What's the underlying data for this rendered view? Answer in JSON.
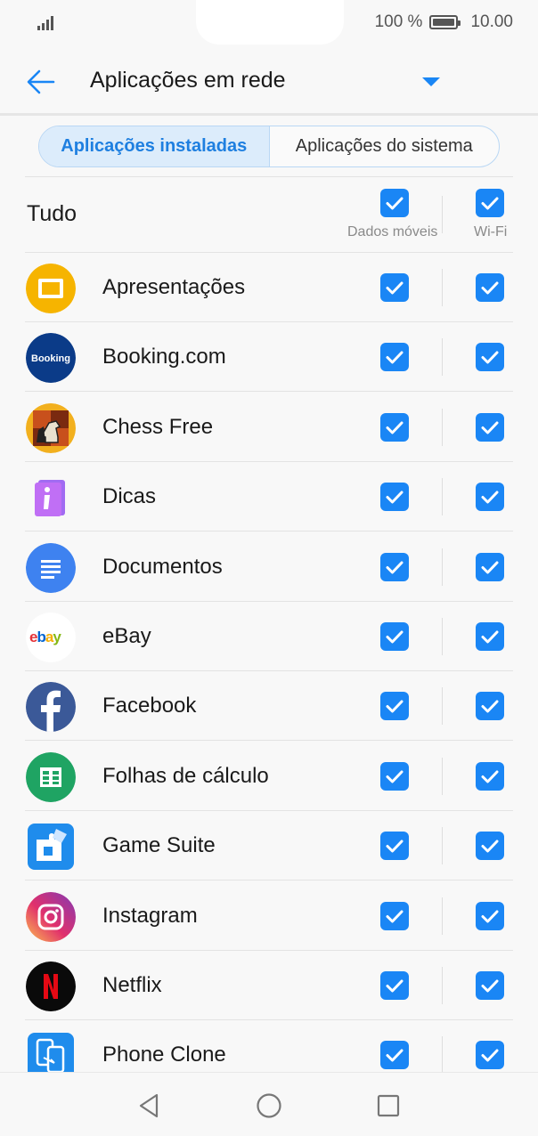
{
  "status": {
    "battery_percent": "100 %",
    "time": "10.00",
    "signal_icon": "signal-icon",
    "battery_icon": "battery-icon"
  },
  "header": {
    "title": "Aplicações em rede",
    "back_icon": "arrow-left-icon",
    "dropdown_icon": "triangle-down-icon"
  },
  "tabs": [
    {
      "label": "Aplicações instaladas",
      "active": true
    },
    {
      "label": "Aplicações do sistema",
      "active": false
    }
  ],
  "all_row": {
    "label": "Tudo",
    "mobile_label": "Dados móveis",
    "wifi_label": "Wi-Fi",
    "mobile_checked": true,
    "wifi_checked": true
  },
  "apps": [
    {
      "name": "Apresentações",
      "icon": "slides-icon",
      "mobile": true,
      "wifi": true
    },
    {
      "name": "Booking.com",
      "icon": "booking-icon",
      "icon_text": "Booking",
      "mobile": true,
      "wifi": true
    },
    {
      "name": "Chess Free",
      "icon": "chess-icon",
      "mobile": true,
      "wifi": true
    },
    {
      "name": "Dicas",
      "icon": "tips-icon",
      "mobile": true,
      "wifi": true
    },
    {
      "name": "Documentos",
      "icon": "docs-icon",
      "mobile": true,
      "wifi": true
    },
    {
      "name": "eBay",
      "icon": "ebay-icon",
      "mobile": true,
      "wifi": true
    },
    {
      "name": "Facebook",
      "icon": "facebook-icon",
      "mobile": true,
      "wifi": true
    },
    {
      "name": "Folhas de cálculo",
      "icon": "sheets-icon",
      "mobile": true,
      "wifi": true
    },
    {
      "name": "Game Suite",
      "icon": "game-suite-icon",
      "mobile": true,
      "wifi": true
    },
    {
      "name": "Instagram",
      "icon": "instagram-icon",
      "mobile": true,
      "wifi": true
    },
    {
      "name": "Netflix",
      "icon": "netflix-icon",
      "mobile": true,
      "wifi": true
    },
    {
      "name": "Phone Clone",
      "icon": "phone-clone-icon",
      "mobile": true,
      "wifi": true
    }
  ],
  "navbar": {
    "back": "nav-back-icon",
    "home": "nav-home-icon",
    "recents": "nav-recents-icon"
  },
  "colors": {
    "accent": "#1a86f5",
    "tab_active_bg": "#dcecfb",
    "tab_active_text": "#1e7fe0"
  }
}
